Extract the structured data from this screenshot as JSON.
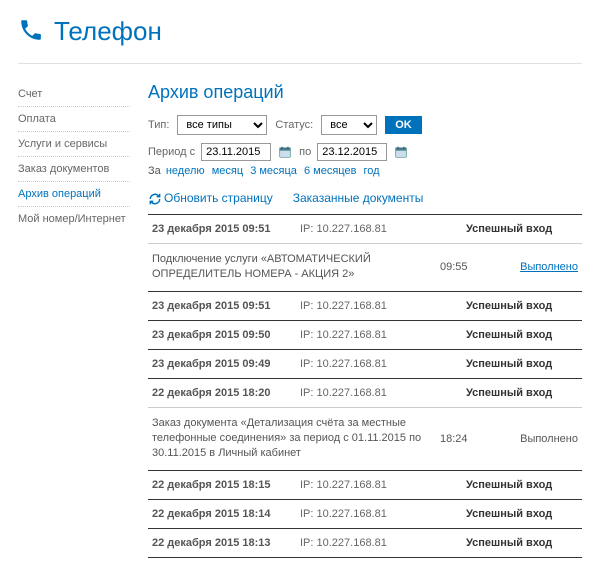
{
  "header": {
    "title": "Телефон"
  },
  "sidebar": {
    "items": [
      {
        "label": "Счет",
        "active": false
      },
      {
        "label": "Оплата",
        "active": false
      },
      {
        "label": "Услуги и сервисы",
        "active": false
      },
      {
        "label": "Заказ документов",
        "active": false
      },
      {
        "label": "Архив операций",
        "active": true
      },
      {
        "label": "Мой номер/Интернет",
        "active": false
      }
    ]
  },
  "main": {
    "heading": "Архив операций",
    "filters": {
      "type_label": "Тип:",
      "type_value": "все типы",
      "status_label": "Статус:",
      "status_value": "все",
      "ok_label": "OK"
    },
    "period": {
      "label_from": "Период с",
      "from": "23.11.2015",
      "label_to": "по",
      "to": "23.12.2015"
    },
    "quick": {
      "prefix": "За",
      "links": [
        "неделю",
        "месяц",
        "3 месяца",
        "6 месяцев",
        "год"
      ]
    },
    "actions": {
      "refresh": "Обновить страницу",
      "ordered_docs": "Заказанные документы"
    },
    "ip_prefix": "IP:",
    "rows": [
      {
        "kind": "login",
        "date": "23 декабря 2015 09:51",
        "ip": "10.227.168.81",
        "status": "Успешный вход"
      },
      {
        "kind": "detail",
        "desc": "Подключение услуги «АВТОМАТИЧЕСКИЙ ОПРЕДЕЛИТЕЛЬ НОМЕРА - АКЦИЯ 2»",
        "time": "09:55",
        "result": "Выполнено",
        "result_link": true
      },
      {
        "kind": "login",
        "date": "23 декабря 2015 09:51",
        "ip": "10.227.168.81",
        "status": "Успешный вход"
      },
      {
        "kind": "login",
        "date": "23 декабря 2015 09:50",
        "ip": "10.227.168.81",
        "status": "Успешный вход"
      },
      {
        "kind": "login",
        "date": "23 декабря 2015 09:49",
        "ip": "10.227.168.81",
        "status": "Успешный вход"
      },
      {
        "kind": "login",
        "date": "22 декабря 2015 18:20",
        "ip": "10.227.168.81",
        "status": "Успешный вход"
      },
      {
        "kind": "detail",
        "desc": "Заказ документа «Детализация счёта за местные телефонные соединения» за период с 01.11.2015 по 30.11.2015 в Личный кабинет",
        "time": "18:24",
        "result": "Выполнено",
        "result_link": false
      },
      {
        "kind": "login",
        "date": "22 декабря 2015 18:15",
        "ip": "10.227.168.81",
        "status": "Успешный вход"
      },
      {
        "kind": "login",
        "date": "22 декабря 2015 18:14",
        "ip": "10.227.168.81",
        "status": "Успешный вход"
      },
      {
        "kind": "login",
        "date": "22 декабря 2015 18:13",
        "ip": "10.227.168.81",
        "status": "Успешный вход"
      }
    ]
  }
}
